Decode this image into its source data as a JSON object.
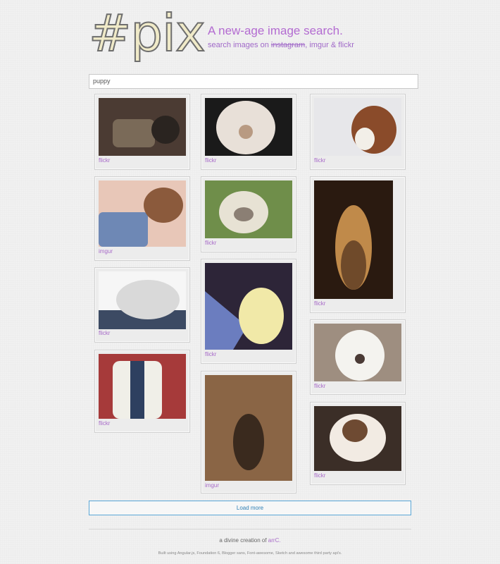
{
  "header": {
    "logo": "#pix",
    "tagline": "A new-age image search.",
    "subline_prefix": "search images on",
    "sources": [
      "instagram",
      "imgur & flickr"
    ]
  },
  "search": {
    "value": "puppy"
  },
  "results": [
    {
      "source": "flickr",
      "palette": [
        "#4b3b33",
        "#7a6a58",
        "#2a2420"
      ]
    },
    {
      "source": "imgur",
      "palette": [
        "#e8c7b8",
        "#8b5a3c",
        "#6e88b5"
      ]
    },
    {
      "source": "flickr",
      "palette": [
        "#f6f6f6",
        "#d9d9d9",
        "#3c4a63"
      ]
    },
    {
      "source": "flickr",
      "palette": [
        "#a63a3a",
        "#f0efe8",
        "#2e4060"
      ]
    },
    {
      "source": "flickr",
      "palette": [
        "#1a1a1a",
        "#e8e0d8",
        "#b89a82"
      ]
    },
    {
      "source": "flickr",
      "palette": [
        "#6f8e4a",
        "#e7e2d4",
        "#8b7f74"
      ]
    },
    {
      "source": "flickr",
      "palette": [
        "#2d2538",
        "#f1e9a8",
        "#6b7dbf"
      ]
    },
    {
      "source": "imgur",
      "palette": [
        "#6b4a2f",
        "#3a2a1e",
        "#9b7452"
      ]
    },
    {
      "source": "flickr",
      "palette": [
        "#e7e7ea",
        "#8a4b2a",
        "#f2efe8"
      ]
    },
    {
      "source": "flickr",
      "palette": [
        "#2a1a10",
        "#c08a4a",
        "#6f4a2a"
      ]
    },
    {
      "source": "flickr",
      "palette": [
        "#9e8e80",
        "#f4f3ef",
        "#4a3a35"
      ]
    },
    {
      "source": "flickr",
      "palette": [
        "#3b2e27",
        "#f2ebe3",
        "#6e4a32"
      ]
    }
  ],
  "load_more": "Load more",
  "footer": {
    "credit_prefix": "a divine creation of",
    "author": "arrC.",
    "built_with": "Built using Angular.js, Foundation 6, Blogger sans, Font-awesome, Sketch and awesome third party api's."
  },
  "colors": {
    "accent": "#b36bd1",
    "link": "#2f7fb4"
  }
}
